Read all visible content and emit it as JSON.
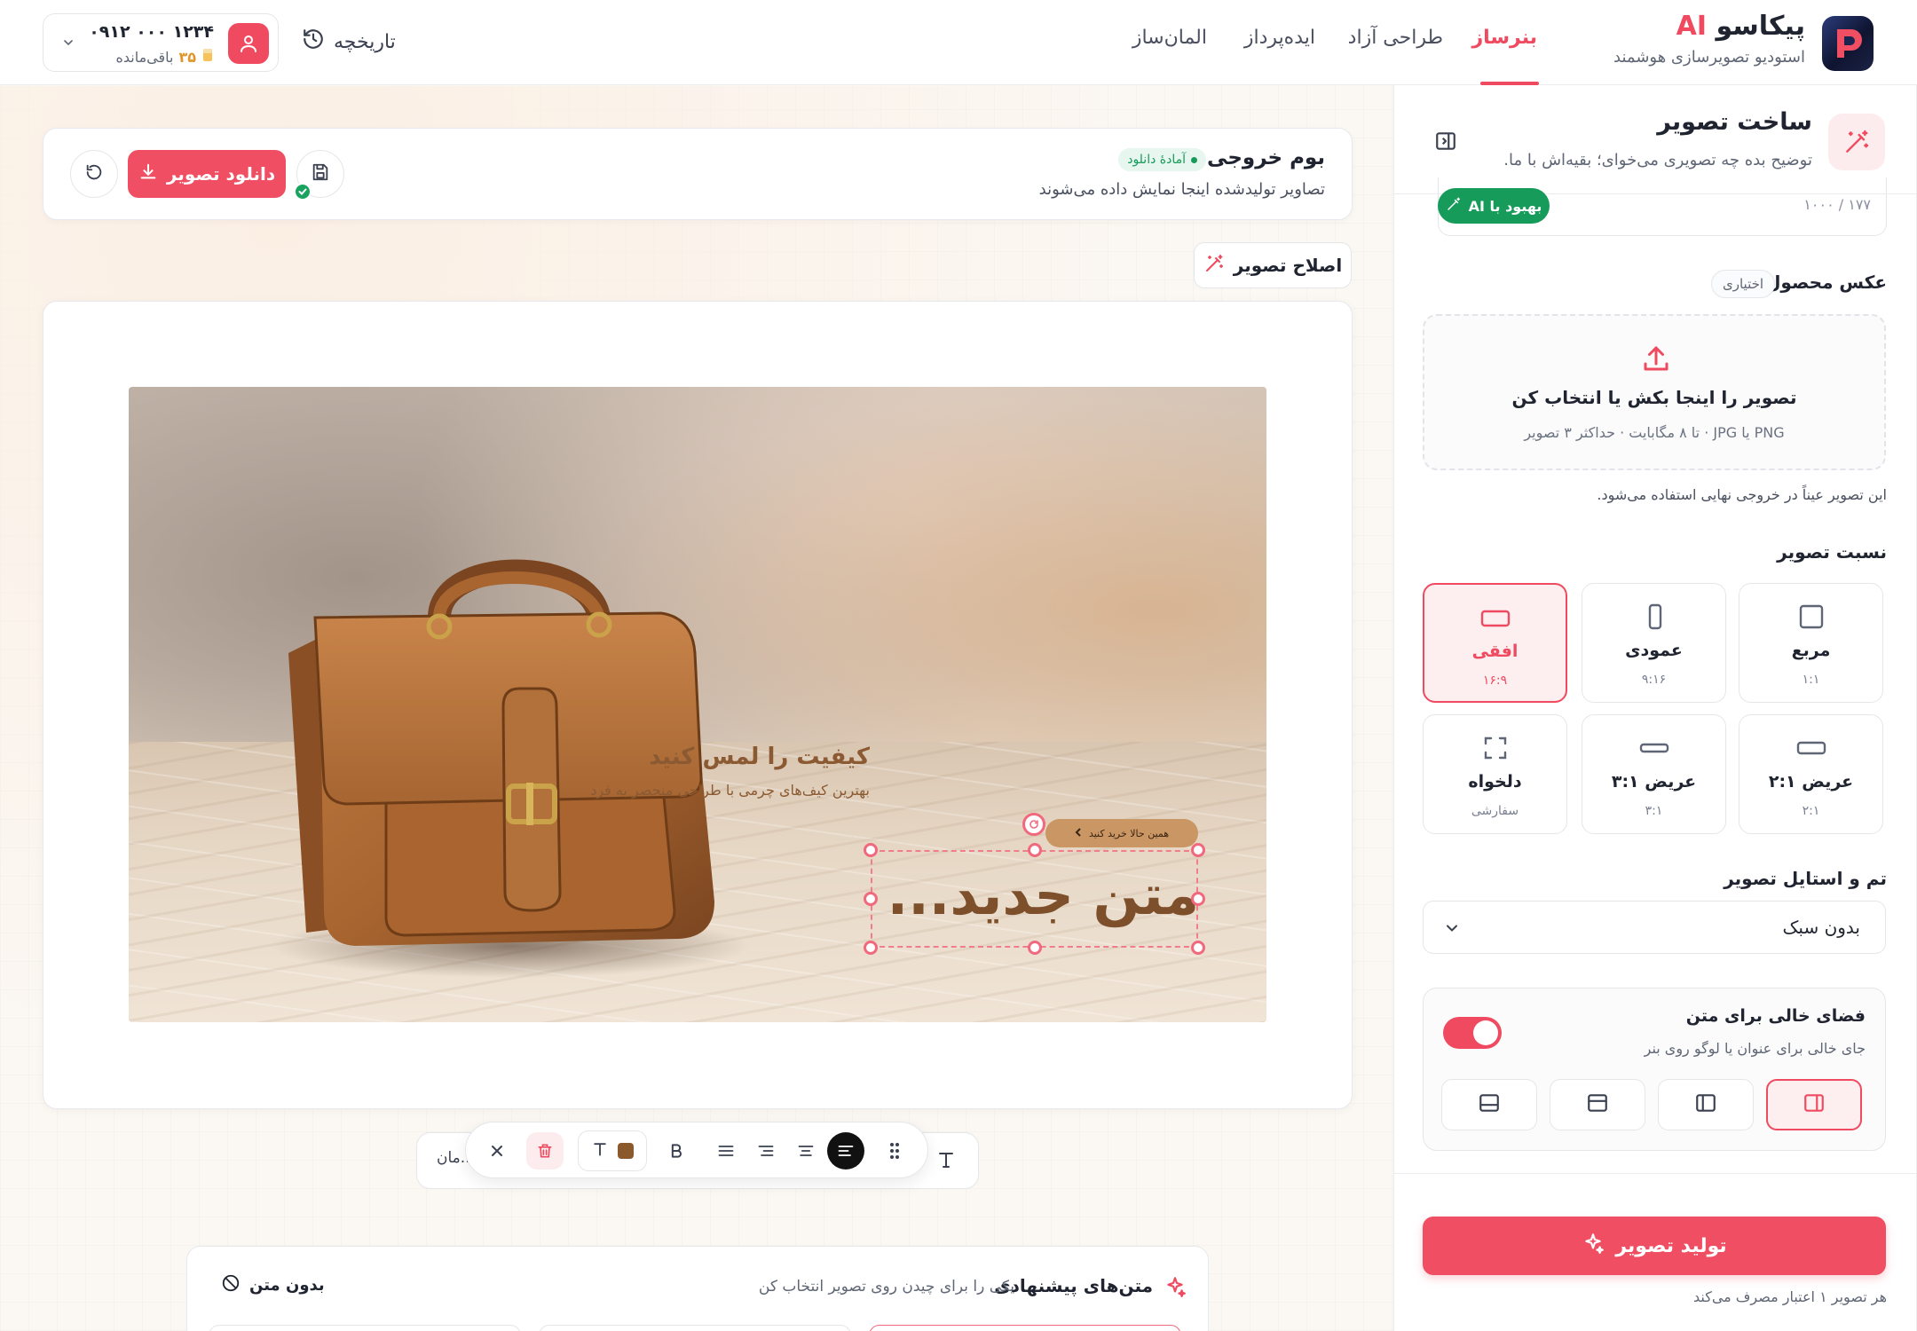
{
  "header": {
    "brand_name": "پیکاسو",
    "brand_ai": "AI",
    "brand_sub": "استودیو تصویرسازی هوشمند",
    "tabs": [
      {
        "label": "بنرساز",
        "active": true
      },
      {
        "label": "طراحی آزاد",
        "active": false
      },
      {
        "label": "ایده‌پرداز",
        "active": false
      },
      {
        "label": "المان‌ساز",
        "active": false
      }
    ],
    "history_label": "تاریخچه",
    "account": {
      "phone": "۰۹۱۲ ۰۰۰ ۱۲۳۴",
      "credits_value": "۳۵",
      "credits_label": "باقی‌مانده"
    }
  },
  "sidebar": {
    "title": "ساخت تصویر",
    "subtitle": "توضیح بده چه تصویری می‌خوای؛ بقیه‌اش با ما.",
    "prompt_counter": "۱۰۰۰ / ۱۷۷",
    "ai_improve_label": "بهبود با AI",
    "product_photo": {
      "label": "عکس محصول",
      "optional_chip": "اختیاری",
      "drop_title": "تصویر را اینجا بکش یا انتخاب کن",
      "drop_sub": "PNG یا JPG · تا ۸ مگابایت · حداکثر ۳ تصویر",
      "note": "این تصویر عیناً در خروجی نهایی استفاده می‌شود."
    },
    "aspect": {
      "label": "نسبت تصویر",
      "options": [
        {
          "name": "مربع",
          "ratio": "۱:۱",
          "icon": "square-icon",
          "selected": false
        },
        {
          "name": "عمودی",
          "ratio": "۹:۱۶",
          "icon": "portrait-icon",
          "selected": false
        },
        {
          "name": "افقی",
          "ratio": "۱۶:۹",
          "icon": "landscape-icon",
          "selected": true
        },
        {
          "name": "عریض ۲:۱",
          "ratio": "۲:۱",
          "icon": "wide-2-1-icon",
          "selected": false
        },
        {
          "name": "عریض ۳:۱",
          "ratio": "۳:۱",
          "icon": "wide-3-1-icon",
          "selected": false
        },
        {
          "name": "دلخواه",
          "ratio": "سفارشی",
          "icon": "custom-crop-icon",
          "selected": false
        }
      ]
    },
    "style": {
      "label": "تم و استایل تصویر",
      "value": "بدون سبک"
    },
    "text_space": {
      "title": "فضای خالی برای متن",
      "subtitle": "جای خالی برای عنوان یا لوگو روی بنر",
      "enabled": true,
      "positions": [
        "right",
        "left",
        "top",
        "bottom"
      ],
      "selected": "right"
    },
    "generate_label": "تولید تصویر",
    "generate_note": "هر تصویر ۱ اعتبار مصرف می‌کند"
  },
  "canvas": {
    "title": "بوم خروجی",
    "ready_label": "آمادهٔ دانلود",
    "subtitle": "تصاویر تولیدشده اینجا نمایش داده می‌شوند",
    "download_label": "دانلود تصویر",
    "fix_label": "اصلاح تصویر",
    "banner": {
      "headline": "کیفیت را لمس کنید",
      "sub": "بهترین کیف‌های چرمی با طراحی منحصر به فرد",
      "cta": "همین حالا خرید کنید",
      "new_text": "متن جدید..."
    }
  },
  "text_toolbar": {
    "partial_text": "...مان"
  },
  "suggestions": {
    "title": "متن‌های پیشنهادی",
    "subtitle": "یکی را برای چیدن روی تصویر انتخاب کن",
    "no_text_label": "بدون متن"
  },
  "colors": {
    "accent": "#ef4a5f",
    "success": "#169b5a",
    "leather": "#8b5a32"
  }
}
